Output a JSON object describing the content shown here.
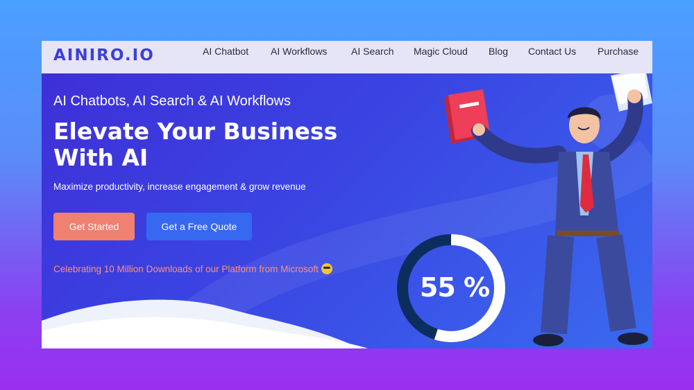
{
  "nav": {
    "logo": "AINIRO.IO",
    "items": [
      {
        "label": "AI Chatbot"
      },
      {
        "label": "AI Workflows"
      },
      {
        "label": "AI Search"
      },
      {
        "label": "Magic Cloud"
      },
      {
        "label": "Blog"
      },
      {
        "label": "Contact Us"
      },
      {
        "label": "Purchase"
      }
    ]
  },
  "hero": {
    "subtitle": "AI Chatbots, AI Search & AI Workflows",
    "headline": "Elevate Your Business With AI",
    "tagline": "Maximize productivity, increase engagement & grow revenue",
    "primary_button": "Get Started",
    "secondary_button": "Get a Free Quote",
    "celebration": "Celebrating 10 Million Downloads of our Platform from Microsoft",
    "gauge_text": "55 %",
    "gauge_value": 0.55
  },
  "colors": {
    "accent": "#3d3fd9",
    "primary_button": "#f0806f",
    "secondary_button": "#3668f0",
    "celebration_text": "#ff9078"
  }
}
